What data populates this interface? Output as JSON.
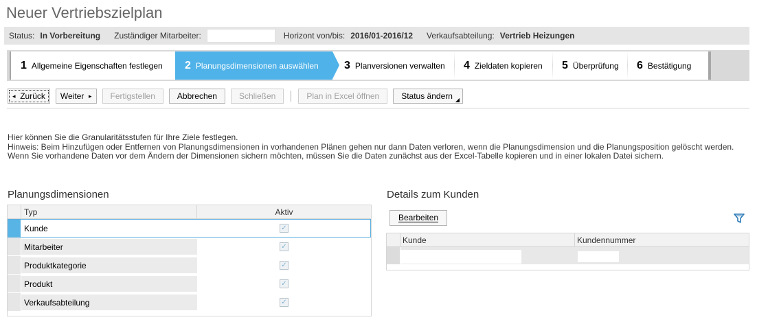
{
  "page": {
    "title": "Neuer Vertriebszielplan"
  },
  "status_bar": {
    "status_label": "Status:",
    "status_value": "In Vorbereitung",
    "employee_label": "Zuständiger Mitarbeiter:",
    "employee_value": "",
    "horizon_label": "Horizont von/bis:",
    "horizon_value": "2016/01-2016/12",
    "dept_label": "Verkaufsabteilung:",
    "dept_value": "Vertrieb Heizungen"
  },
  "roadmap": {
    "steps": [
      {
        "num": "1",
        "label": "Allgemeine Eigenschaften festlegen",
        "active": false
      },
      {
        "num": "2",
        "label": "Planungsdimensionen auswählen",
        "active": true
      },
      {
        "num": "3",
        "label": "Planversionen verwalten",
        "active": false
      },
      {
        "num": "4",
        "label": "Zieldaten kopieren",
        "active": false
      },
      {
        "num": "5",
        "label": "Überprüfung",
        "active": false
      },
      {
        "num": "6",
        "label": "Bestätigung",
        "active": false
      }
    ]
  },
  "toolbar": {
    "back_label": "Zurück",
    "next_label": "Weiter",
    "finish_label": "Fertigstellen",
    "cancel_label": "Abbrechen",
    "close_label": "Schließen",
    "excel_label": "Plan in Excel öffnen",
    "status_label": "Status ändern"
  },
  "hint": {
    "line1": "Hier können Sie die Granularitätsstufen für Ihre Ziele festlegen.",
    "line2": "Hinweis: Beim Hinzufügen oder Entfernen von Planungsdimensionen in vorhandenen Plänen gehen nur dann Daten verloren, wenn die Planungsdimension und die Planungsposition gelöscht werden.",
    "line3": "Wenn Sie vorhandene Daten vor dem Ändern der Dimensionen sichern möchten, müssen Sie die Daten zunächst aus der Excel-Tabelle kopieren und in einer lokalen Datei sichern."
  },
  "dimensions": {
    "title": "Planungsdimensionen",
    "col_type": "Typ",
    "col_active": "Aktiv",
    "rows": [
      {
        "type": "Kunde",
        "active": true,
        "selected": true
      },
      {
        "type": "Mitarbeiter",
        "active": true,
        "selected": false
      },
      {
        "type": "Produktkategorie",
        "active": true,
        "selected": false
      },
      {
        "type": "Produkt",
        "active": true,
        "selected": false
      },
      {
        "type": "Verkaufsabteilung",
        "active": true,
        "selected": false
      }
    ]
  },
  "customer_details": {
    "title": "Details zum Kunden",
    "edit_label": "Bearbeiten",
    "col_customer": "Kunde",
    "col_number": "Kundennummer",
    "rows": [
      {
        "customer": "",
        "number": ""
      }
    ]
  },
  "colors": {
    "accent": "#4fb2e8",
    "bar_bg": "#e5e5e5"
  }
}
